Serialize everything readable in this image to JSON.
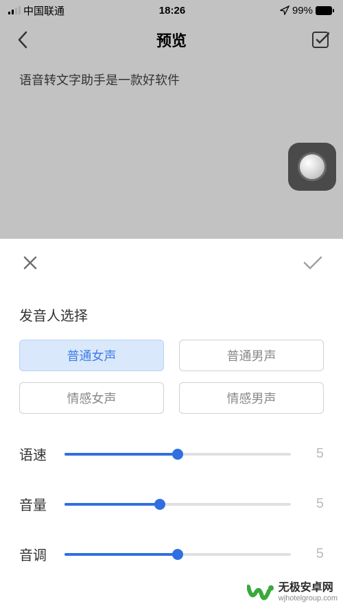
{
  "status_bar": {
    "carrier": "中国联通",
    "time": "18:26",
    "battery_percent": "99%"
  },
  "nav": {
    "title": "预览"
  },
  "content": {
    "text": "语音转文字助手是一款好软件"
  },
  "sheet": {
    "title": "发音人选择",
    "voices": [
      {
        "label": "普通女声",
        "selected": true
      },
      {
        "label": "普通男声",
        "selected": false
      },
      {
        "label": "情感女声",
        "selected": false
      },
      {
        "label": "情感男声",
        "selected": false
      }
    ],
    "sliders": [
      {
        "label": "语速",
        "value": 5,
        "max": 10,
        "fill": 50
      },
      {
        "label": "音量",
        "value": 5,
        "max": 10,
        "fill": 42
      },
      {
        "label": "音调",
        "value": 5,
        "max": 10,
        "fill": 50
      }
    ]
  },
  "watermark": {
    "title": "无极安卓网",
    "sub": "wjhotelgroup.com"
  }
}
